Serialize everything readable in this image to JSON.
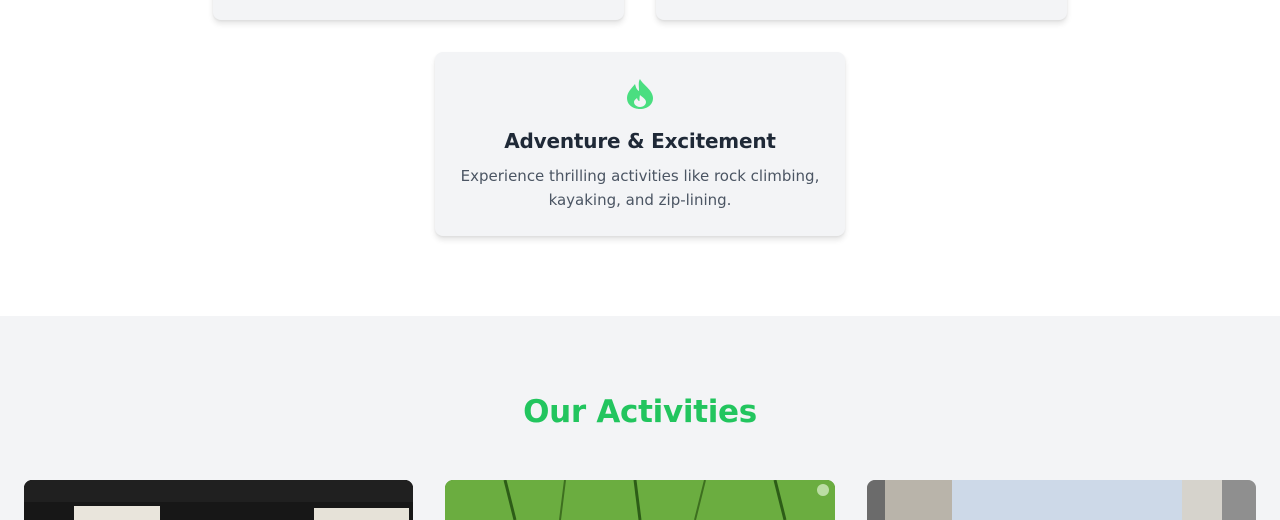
{
  "feature": {
    "icon": "fire-icon",
    "title": "Adventure & Excitement",
    "description": "Experience thrilling activities like rock climbing, kayaking, and zip-lining."
  },
  "activities": {
    "heading": "Our Activities",
    "cards": [
      {
        "image": "activity-image-1"
      },
      {
        "image": "activity-image-2"
      },
      {
        "image": "activity-image-3"
      }
    ]
  },
  "colors": {
    "accent_green": "#22c55e",
    "card_bg": "#f3f4f6",
    "title_text": "#1f2937",
    "body_text": "#4b5563"
  }
}
